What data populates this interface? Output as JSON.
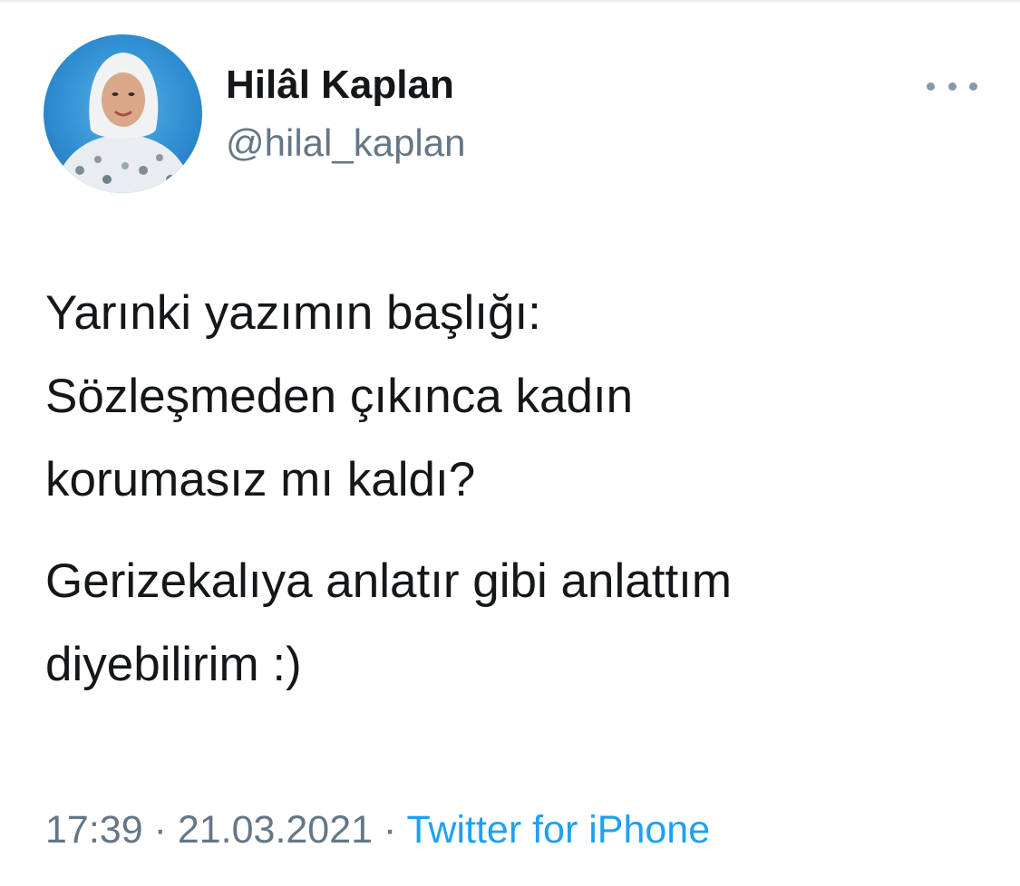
{
  "tweet": {
    "author": {
      "display_name": "Hilâl Kaplan",
      "handle": "@hilal_kaplan"
    },
    "more_icon": "ellipsis-icon",
    "text": {
      "paragraph_1": "Yarınki yazımın başlığı:\nSözleşmeden çıkınca kadın\nkorumasız mı kaldı?",
      "paragraph_2": "Gerizekalıya anlatır gibi anlattım\ndiyebilirim :)"
    },
    "meta": {
      "time": "17:39",
      "separator": "·",
      "date": "21.03.2021",
      "source": "Twitter for iPhone"
    },
    "colors": {
      "text": "#14171a",
      "secondary": "#657786",
      "link": "#1da1f2"
    }
  }
}
